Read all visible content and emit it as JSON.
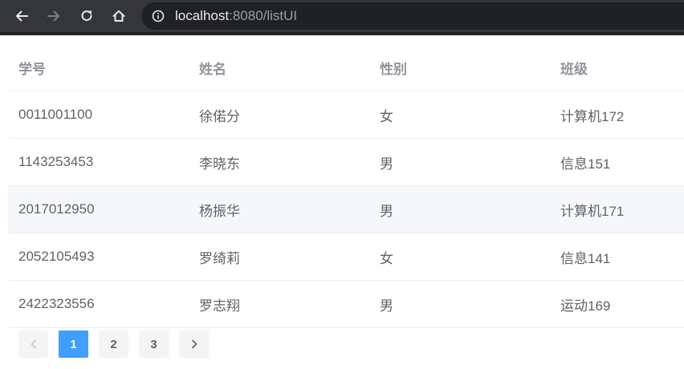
{
  "browser": {
    "url_host": "localhost",
    "url_rest": ":8080/listUI"
  },
  "table": {
    "headers": [
      "学号",
      "姓名",
      "性别",
      "班级"
    ],
    "rows": [
      [
        "0011001100",
        "徐偌分",
        "女",
        "计算机172"
      ],
      [
        "1143253453",
        "李晓东",
        "男",
        "信息151"
      ],
      [
        "2017012950",
        "杨振华",
        "男",
        "计算机171"
      ],
      [
        "2052105493",
        "罗绮莉",
        "女",
        "信息141"
      ],
      [
        "2422323556",
        "罗志翔",
        "男",
        "运动169"
      ]
    ],
    "hovered_row_index": 2
  },
  "pagination": {
    "pages": [
      "1",
      "2",
      "3"
    ],
    "current_page": "1",
    "prev_icon": "chevron-left-icon",
    "next_icon": "chevron-right-icon"
  },
  "colors": {
    "accent": "#409eff",
    "toolbar_bg": "#35363a",
    "omnibox_bg": "#202124",
    "row_hover": "#f5f7fa",
    "header_text": "#909399",
    "body_text": "#606266"
  }
}
